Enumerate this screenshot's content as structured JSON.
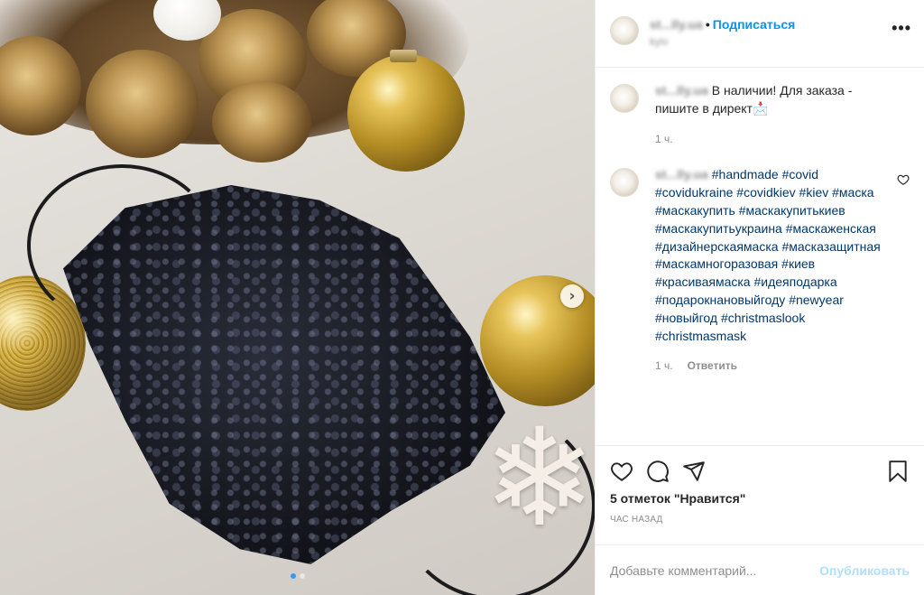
{
  "header": {
    "username": "st...lly.ua",
    "separator": "•",
    "follow_label": "Подписаться",
    "location": "kyiv",
    "more_label": "•••"
  },
  "caption": {
    "username": "st...lly.ua",
    "text": "В наличии! Для заказа - пишите в директ",
    "emoji": "📩",
    "time": "1 ч."
  },
  "comment": {
    "username": "st...lly.ua",
    "hashtags": [
      "#handmade",
      "#covid",
      "#covidukraine",
      "#covidkiev",
      "#kiev",
      "#маска",
      "#маскакупить",
      "#маскакупитькиев",
      "#маскакупитьукраина",
      "#маскаженская",
      "#дизайнерскаямаска",
      "#масказащитная",
      "#маскамногоразовая",
      "#киев",
      "#красиваямаска",
      "#идеяподарка",
      "#подарокнановыйгоду",
      "#newyear",
      "#новыйгод",
      "#christmaslook",
      "#christmasmask"
    ],
    "time": "1 ч.",
    "reply_label": "Ответить"
  },
  "actions": {
    "likes": "5 отметок \"Нравится\"",
    "time_ago": "час назад"
  },
  "add_comment": {
    "placeholder": "Добавьте комментарий...",
    "post_label": "Опубликовать"
  },
  "media": {
    "next_arrow": "›",
    "carousel_count": 2,
    "carousel_active": 1
  }
}
